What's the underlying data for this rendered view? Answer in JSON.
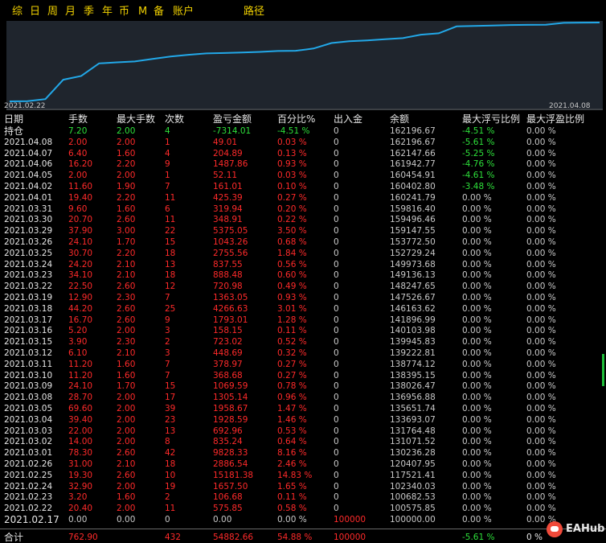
{
  "tabs": [
    "综",
    "日",
    "周",
    "月",
    "季",
    "年",
    "币",
    "M",
    "备",
    "账户",
    "路径"
  ],
  "chart_data": {
    "type": "line",
    "x_start_label": "2021.02.22",
    "x_end_label": "2021.04.08",
    "line_color": "#22a8e8",
    "x": [
      "2021.02.22",
      "2021.02.23",
      "2021.02.24",
      "2021.02.25",
      "2021.02.26",
      "2021.03.01",
      "2021.03.02",
      "2021.03.03",
      "2021.03.04",
      "2021.03.05",
      "2021.03.08",
      "2021.03.09",
      "2021.03.10",
      "2021.03.11",
      "2021.03.12",
      "2021.03.15",
      "2021.03.16",
      "2021.03.17",
      "2021.03.18",
      "2021.03.19",
      "2021.03.22",
      "2021.03.23",
      "2021.03.24",
      "2021.03.25",
      "2021.03.26",
      "2021.03.29",
      "2021.03.30",
      "2021.03.31",
      "2021.04.01",
      "2021.04.02",
      "2021.04.05",
      "2021.04.06",
      "2021.04.07",
      "2021.04.08"
    ],
    "y": [
      100575.85,
      100682.53,
      102340.03,
      117521.41,
      120407.95,
      130236.28,
      131071.52,
      131764.48,
      133693.07,
      135651.74,
      136956.88,
      138026.47,
      138395.15,
      138774.12,
      139222.81,
      139945.83,
      140103.98,
      141896.99,
      146163.62,
      147526.67,
      148247.65,
      149136.13,
      149973.68,
      152729.24,
      153772.5,
      159147.55,
      159496.46,
      159816.4,
      160241.79,
      160402.8,
      160454.91,
      161942.77,
      162147.66,
      162196.67
    ]
  },
  "table": {
    "headers": [
      "日期",
      "手数",
      "最大手数",
      "次数",
      "盈亏金额",
      "百分比%",
      "出入金",
      "余额",
      "最大浮亏比例",
      "最大浮盈比例"
    ],
    "rows": [
      {
        "kind": "hold",
        "c": [
          "持仓",
          "7.20",
          "2.00",
          "4",
          "-7314.01",
          "-4.51 %",
          "0",
          "162196.67",
          "-4.51 %",
          "0.00 %"
        ]
      },
      {
        "c": [
          "2021.04.08",
          "2.00",
          "2.00",
          "1",
          "49.01",
          "0.03 %",
          "0",
          "162196.67",
          "-5.61 %",
          "0.00 %"
        ]
      },
      {
        "c": [
          "2021.04.07",
          "6.40",
          "1.60",
          "4",
          "204.89",
          "0.13 %",
          "0",
          "162147.66",
          "-5.25 %",
          "0.00 %"
        ]
      },
      {
        "c": [
          "2021.04.06",
          "16.20",
          "2.20",
          "9",
          "1487.86",
          "0.93 %",
          "0",
          "161942.77",
          "-4.76 %",
          "0.00 %"
        ]
      },
      {
        "c": [
          "2021.04.05",
          "2.00",
          "2.00",
          "1",
          "52.11",
          "0.03 %",
          "0",
          "160454.91",
          "-4.61 %",
          "0.00 %"
        ]
      },
      {
        "c": [
          "2021.04.02",
          "11.60",
          "1.90",
          "7",
          "161.01",
          "0.10 %",
          "0",
          "160402.80",
          "-3.48 %",
          "0.00 %"
        ]
      },
      {
        "c": [
          "2021.04.01",
          "19.40",
          "2.20",
          "11",
          "425.39",
          "0.27 %",
          "0",
          "160241.79",
          "0.00 %",
          "0.00 %"
        ]
      },
      {
        "c": [
          "2021.03.31",
          "9.60",
          "1.60",
          "6",
          "319.94",
          "0.20 %",
          "0",
          "159816.40",
          "0.00 %",
          "0.00 %"
        ]
      },
      {
        "c": [
          "2021.03.30",
          "20.70",
          "2.60",
          "11",
          "348.91",
          "0.22 %",
          "0",
          "159496.46",
          "0.00 %",
          "0.00 %"
        ]
      },
      {
        "c": [
          "2021.03.29",
          "37.90",
          "3.00",
          "22",
          "5375.05",
          "3.50 %",
          "0",
          "159147.55",
          "0.00 %",
          "0.00 %"
        ]
      },
      {
        "c": [
          "2021.03.26",
          "24.10",
          "1.70",
          "15",
          "1043.26",
          "0.68 %",
          "0",
          "153772.50",
          "0.00 %",
          "0.00 %"
        ]
      },
      {
        "c": [
          "2021.03.25",
          "30.70",
          "2.20",
          "18",
          "2755.56",
          "1.84 %",
          "0",
          "152729.24",
          "0.00 %",
          "0.00 %"
        ]
      },
      {
        "c": [
          "2021.03.24",
          "24.20",
          "2.10",
          "13",
          "837.55",
          "0.56 %",
          "0",
          "149973.68",
          "0.00 %",
          "0.00 %"
        ]
      },
      {
        "c": [
          "2021.03.23",
          "34.10",
          "2.10",
          "18",
          "888.48",
          "0.60 %",
          "0",
          "149136.13",
          "0.00 %",
          "0.00 %"
        ]
      },
      {
        "c": [
          "2021.03.22",
          "22.50",
          "2.60",
          "12",
          "720.98",
          "0.49 %",
          "0",
          "148247.65",
          "0.00 %",
          "0.00 %"
        ]
      },
      {
        "c": [
          "2021.03.19",
          "12.90",
          "2.30",
          "7",
          "1363.05",
          "0.93 %",
          "0",
          "147526.67",
          "0.00 %",
          "0.00 %"
        ]
      },
      {
        "c": [
          "2021.03.18",
          "44.20",
          "2.60",
          "25",
          "4266.63",
          "3.01 %",
          "0",
          "146163.62",
          "0.00 %",
          "0.00 %"
        ]
      },
      {
        "c": [
          "2021.03.17",
          "16.70",
          "2.60",
          "9",
          "1793.01",
          "1.28 %",
          "0",
          "141896.99",
          "0.00 %",
          "0.00 %"
        ]
      },
      {
        "c": [
          "2021.03.16",
          "5.20",
          "2.00",
          "3",
          "158.15",
          "0.11 %",
          "0",
          "140103.98",
          "0.00 %",
          "0.00 %"
        ]
      },
      {
        "c": [
          "2021.03.15",
          "3.90",
          "2.30",
          "2",
          "723.02",
          "0.52 %",
          "0",
          "139945.83",
          "0.00 %",
          "0.00 %"
        ]
      },
      {
        "c": [
          "2021.03.12",
          "6.10",
          "2.10",
          "3",
          "448.69",
          "0.32 %",
          "0",
          "139222.81",
          "0.00 %",
          "0.00 %"
        ]
      },
      {
        "c": [
          "2021.03.11",
          "11.20",
          "1.60",
          "7",
          "378.97",
          "0.27 %",
          "0",
          "138774.12",
          "0.00 %",
          "0.00 %"
        ]
      },
      {
        "c": [
          "2021.03.10",
          "11.20",
          "1.60",
          "7",
          "368.68",
          "0.27 %",
          "0",
          "138395.15",
          "0.00 %",
          "0.00 %"
        ]
      },
      {
        "c": [
          "2021.03.09",
          "24.10",
          "1.70",
          "15",
          "1069.59",
          "0.78 %",
          "0",
          "138026.47",
          "0.00 %",
          "0.00 %"
        ]
      },
      {
        "c": [
          "2021.03.08",
          "28.70",
          "2.00",
          "17",
          "1305.14",
          "0.96 %",
          "0",
          "136956.88",
          "0.00 %",
          "0.00 %"
        ]
      },
      {
        "c": [
          "2021.03.05",
          "69.60",
          "2.00",
          "39",
          "1958.67",
          "1.47 %",
          "0",
          "135651.74",
          "0.00 %",
          "0.00 %"
        ]
      },
      {
        "c": [
          "2021.03.04",
          "39.40",
          "2.00",
          "23",
          "1928.59",
          "1.46 %",
          "0",
          "133693.07",
          "0.00 %",
          "0.00 %"
        ]
      },
      {
        "c": [
          "2021.03.03",
          "22.00",
          "2.00",
          "13",
          "692.96",
          "0.53 %",
          "0",
          "131764.48",
          "0.00 %",
          "0.00 %"
        ]
      },
      {
        "c": [
          "2021.03.02",
          "14.00",
          "2.00",
          "8",
          "835.24",
          "0.64 %",
          "0",
          "131071.52",
          "0.00 %",
          "0.00 %"
        ]
      },
      {
        "c": [
          "2021.03.01",
          "78.30",
          "2.60",
          "42",
          "9828.33",
          "8.16 %",
          "0",
          "130236.28",
          "0.00 %",
          "0.00 %"
        ]
      },
      {
        "c": [
          "2021.02.26",
          "31.00",
          "2.10",
          "18",
          "2886.54",
          "2.46 %",
          "0",
          "120407.95",
          "0.00 %",
          "0.00 %"
        ]
      },
      {
        "c": [
          "2021.02.25",
          "19.30",
          "2.60",
          "10",
          "15181.38",
          "14.83 %",
          "0",
          "117521.41",
          "0.00 %",
          "0.00 %"
        ]
      },
      {
        "c": [
          "2021.02.24",
          "32.90",
          "2.00",
          "19",
          "1657.50",
          "1.65 %",
          "0",
          "102340.03",
          "0.00 %",
          "0.00 %"
        ]
      },
      {
        "c": [
          "2021.02.23",
          "3.20",
          "1.60",
          "2",
          "106.68",
          "0.11 %",
          "0",
          "100682.53",
          "0.00 %",
          "0.00 %"
        ]
      },
      {
        "c": [
          "2021.02.22",
          "20.40",
          "2.00",
          "11",
          "575.85",
          "0.58 %",
          "0",
          "100575.85",
          "0.00 %",
          "0.00 %"
        ]
      },
      {
        "kind": "deposit",
        "c": [
          "2021.02.17",
          "0.00",
          "0.00",
          "0",
          "0.00",
          "0.00 %",
          "100000",
          "100000.00",
          "0.00 %",
          "0.00 %"
        ]
      },
      {
        "kind": "total",
        "c": [
          "合计",
          "762.90",
          "",
          "432",
          "54882.66",
          "54.88 %",
          "100000",
          "",
          "-5.61 %",
          "0 %"
        ]
      }
    ]
  },
  "brand": "EAHub"
}
